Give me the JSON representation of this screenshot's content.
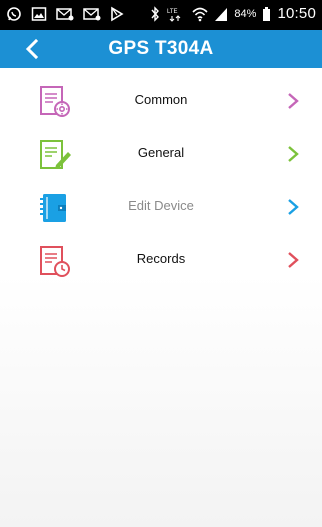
{
  "status_bar": {
    "battery": "84%",
    "time": "10:50",
    "network": "LTE"
  },
  "header": {
    "title": "GPS T304A",
    "background": "#1c90d4"
  },
  "menu": {
    "items": [
      {
        "label": "Common",
        "icon": "document-settings-icon",
        "color": "#c566b8"
      },
      {
        "label": "General",
        "icon": "document-edit-icon",
        "color": "#7cc23b"
      },
      {
        "label": "Edit Device",
        "icon": "notebook-icon",
        "color": "#1aa0e4"
      },
      {
        "label": "Records",
        "icon": "document-clock-icon",
        "color": "#e0505c"
      }
    ]
  }
}
